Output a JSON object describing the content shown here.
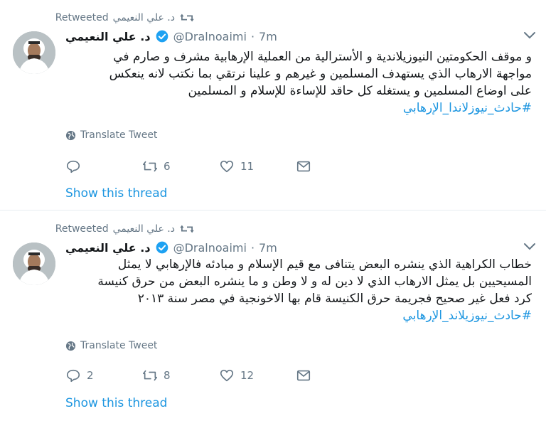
{
  "tweets": [
    {
      "retweeted_by": "د. علي النعيمي",
      "retweeted_label": "Retweeted",
      "display_name": "د. علي النعيمي",
      "handle": "@Dralnoaimi",
      "separator": "·",
      "time": "7m",
      "lines": [
        "و موقف الحكومتين النيوزيلاندية و الأسترالية من العملية الإرهابية مشرف و صارم في",
        "مواجهة الارهاب الذي يستهدف المسلمين و غيرهم و علينا نرتقي بما نكتب لانه ينعكس",
        "على اوضاع المسلمين و يستغله كل حاقد للإساءة للإسلام و المسلمين"
      ],
      "hashtag": "#حادث_نيوزلاندا_الإرهابي",
      "translate_label": "Translate Tweet",
      "reply_count": "",
      "retweet_count": "6",
      "like_count": "11",
      "show_thread": "Show this thread"
    },
    {
      "retweeted_by": "د. علي النعيمي",
      "retweeted_label": "Retweeted",
      "display_name": "د. علي النعيمي",
      "handle": "@Dralnoaimi",
      "separator": "·",
      "time": "7m",
      "lines": [
        "خطاب الكراهية الذي ينشره البعض يتنافى مع قيم الإسلام و مبادئه فالإرهابي لا يمثل",
        "المسيحيين بل يمثل الارهاب الذي لا دين له و لا وطن و ما ينشره البعض من حرق كنيسة",
        "كرد فعل غير صحيح فجريمة حرق الكنيسة قام بها الاخونجية في مصر سنة ٢٠١٣"
      ],
      "hashtag": "#حادث_نيوزيلاند_الإرهابي",
      "translate_label": "Translate Tweet",
      "reply_count": "2",
      "retweet_count": "8",
      "like_count": "12",
      "show_thread": "Show this thread"
    }
  ],
  "colors": {
    "text": "#14171a",
    "muted": "#657786",
    "link": "#1b95e0",
    "verified": "#1da1f2",
    "divider": "#e6ecf0"
  },
  "icons": {
    "retweet_indicator": "retweet-icon",
    "verified": "verified-badge-icon",
    "caret": "chevron-down-icon",
    "translate": "globe-icon",
    "reply": "reply-icon",
    "retweet": "retweet-icon",
    "like": "heart-icon",
    "message": "direct-message-icon"
  }
}
